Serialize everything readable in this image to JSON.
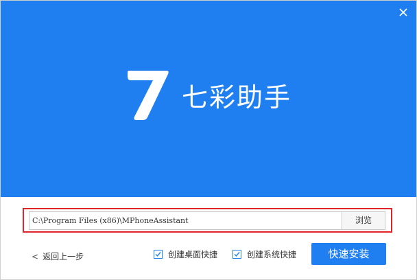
{
  "header": {
    "logo_icon": "seven-logo-icon",
    "app_title": "七彩助手",
    "close_icon": "close-icon",
    "background_color": "#1f7ff0"
  },
  "install_path": {
    "value": "C:\\Program Files (x86)\\MPhoneAssistant",
    "browse_label": "浏览",
    "highlight_color": "#e0242c"
  },
  "footer": {
    "back_label": "返回上一步",
    "options": [
      {
        "label": "创建桌面快捷",
        "checked": true
      },
      {
        "label": "创建系统快捷",
        "checked": true
      }
    ],
    "install_label": "快速安装"
  }
}
